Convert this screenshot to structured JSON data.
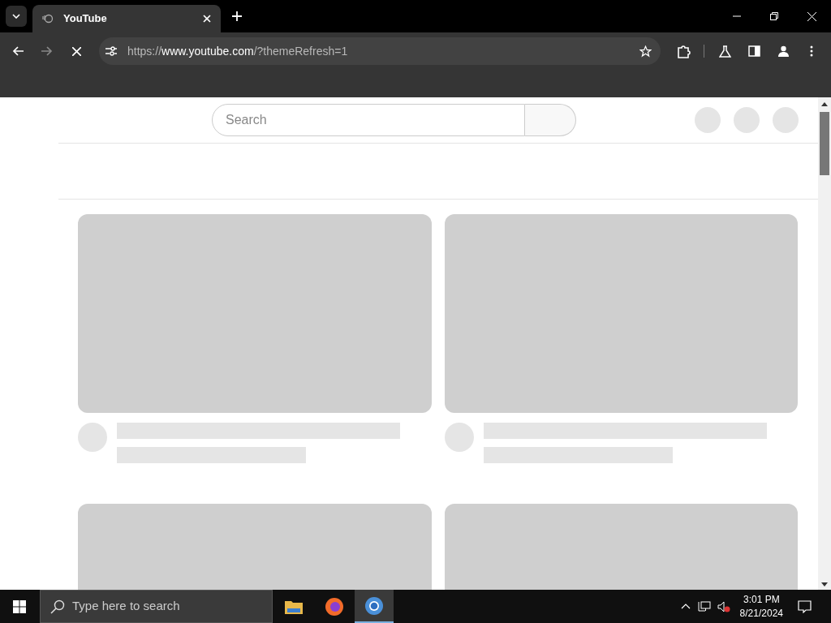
{
  "browser": {
    "tab": {
      "title": "YouTube"
    },
    "address": {
      "scheme": "https://",
      "host": "www.youtube.com",
      "path": "/?themeRefresh=1"
    }
  },
  "page": {
    "search": {
      "placeholder": "Search"
    }
  },
  "taskbar": {
    "search": {
      "placeholder": "Type here to search"
    },
    "time": "3:01 PM",
    "date": "8/21/2024"
  }
}
